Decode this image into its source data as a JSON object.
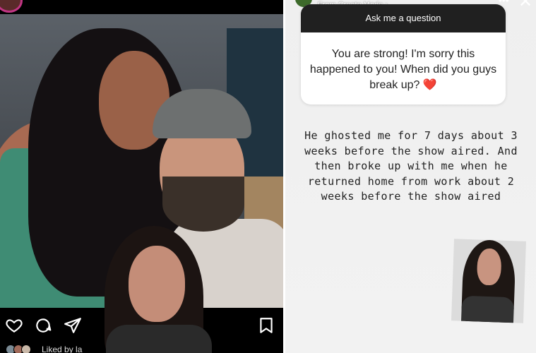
{
  "instagram_post": {
    "username": "",
    "liked_by_text": "Liked by la",
    "actions": [
      {
        "icon": "heart-icon"
      },
      {
        "icon": "comment-icon"
      },
      {
        "icon": "share-icon"
      },
      {
        "icon": "bookmark-icon"
      }
    ]
  },
  "story": {
    "source_label": "From Create Mode ›",
    "question_box": {
      "header": "Ask me a question",
      "question": "You are strong! I'm sorry this happened to you! When did you guys break up? ❤️"
    },
    "answer": "He ghosted me for 7 days about 3 weeks before the show aired. And then broke up with me when he returned home from work about 2 weeks before the show aired",
    "more_icon": "more-icon",
    "close_icon": "close-icon"
  },
  "colors": {
    "story_bg": "#efefef",
    "question_header_bg": "#202020",
    "heart_emoji_red": "#e0245e",
    "dress_green": "#3f8c74"
  }
}
